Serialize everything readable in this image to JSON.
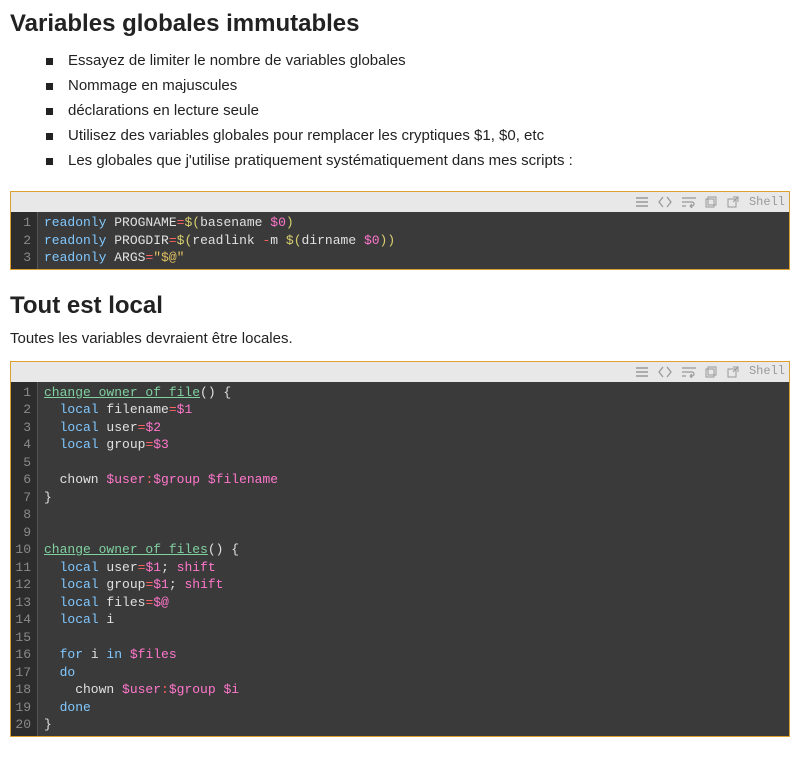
{
  "section1": {
    "heading": "Variables globales immutables",
    "bullets": [
      "Essayez de limiter le nombre de variables globales",
      "Nommage en majuscules",
      "déclarations en lecture seule",
      "Utilisez des variables globales pour remplacer les cryptiques $1, $0, etc",
      "Les globales que j'utilise pratiquement systématiquement dans mes scripts :"
    ]
  },
  "code1": {
    "lang": "Shell",
    "lines": [
      [
        [
          "kw",
          "readonly"
        ],
        [
          "cmd",
          " PROGNAME"
        ],
        [
          "op",
          "="
        ],
        [
          "subsh",
          "$("
        ],
        [
          "cmd",
          "basename "
        ],
        [
          "arg",
          "$0"
        ],
        [
          "subsh",
          ")"
        ]
      ],
      [
        [
          "kw",
          "readonly"
        ],
        [
          "cmd",
          " PROGDIR"
        ],
        [
          "op",
          "="
        ],
        [
          "subsh",
          "$("
        ],
        [
          "cmd",
          "readlink "
        ],
        [
          "op",
          "-"
        ],
        [
          "cmd",
          "m "
        ],
        [
          "subsh",
          "$("
        ],
        [
          "cmd",
          "dirname "
        ],
        [
          "arg",
          "$0"
        ],
        [
          "subsh",
          "))"
        ]
      ],
      [
        [
          "kw",
          "readonly"
        ],
        [
          "cmd",
          " ARGS"
        ],
        [
          "op",
          "="
        ],
        [
          "str",
          "\"$@\""
        ]
      ]
    ]
  },
  "section2": {
    "heading": "Tout est local",
    "para": "Toutes les variables devraient être locales."
  },
  "code2": {
    "lang": "Shell",
    "lines": [
      [
        [
          "fn",
          "change_owner_of_file"
        ],
        [
          "brace",
          "() {"
        ]
      ],
      [
        [
          "cmd",
          "  "
        ],
        [
          "kw",
          "local"
        ],
        [
          "cmd",
          " filename"
        ],
        [
          "op",
          "="
        ],
        [
          "arg",
          "$1"
        ]
      ],
      [
        [
          "cmd",
          "  "
        ],
        [
          "kw",
          "local"
        ],
        [
          "cmd",
          " user"
        ],
        [
          "op",
          "="
        ],
        [
          "arg",
          "$2"
        ]
      ],
      [
        [
          "cmd",
          "  "
        ],
        [
          "kw",
          "local"
        ],
        [
          "cmd",
          " group"
        ],
        [
          "op",
          "="
        ],
        [
          "arg",
          "$3"
        ]
      ],
      [
        [
          "cmd",
          " "
        ]
      ],
      [
        [
          "cmd",
          "  chown "
        ],
        [
          "arg",
          "$user"
        ],
        [
          "op",
          ":"
        ],
        [
          "arg",
          "$group"
        ],
        [
          "cmd",
          " "
        ],
        [
          "arg",
          "$filename"
        ]
      ],
      [
        [
          "brace",
          "}"
        ]
      ],
      [
        [
          "cmd",
          " "
        ]
      ],
      [
        [
          "cmd",
          " "
        ]
      ],
      [
        [
          "fn",
          "change_owner_of_files"
        ],
        [
          "brace",
          "() {"
        ]
      ],
      [
        [
          "cmd",
          "  "
        ],
        [
          "kw",
          "local"
        ],
        [
          "cmd",
          " user"
        ],
        [
          "op",
          "="
        ],
        [
          "arg",
          "$1"
        ],
        [
          "cmd",
          "; "
        ],
        [
          "arg",
          "shift"
        ]
      ],
      [
        [
          "cmd",
          "  "
        ],
        [
          "kw",
          "local"
        ],
        [
          "cmd",
          " group"
        ],
        [
          "op",
          "="
        ],
        [
          "arg",
          "$1"
        ],
        [
          "cmd",
          "; "
        ],
        [
          "arg",
          "shift"
        ]
      ],
      [
        [
          "cmd",
          "  "
        ],
        [
          "kw",
          "local"
        ],
        [
          "cmd",
          " files"
        ],
        [
          "op",
          "="
        ],
        [
          "arg",
          "$@"
        ]
      ],
      [
        [
          "cmd",
          "  "
        ],
        [
          "kw",
          "local"
        ],
        [
          "cmd",
          " i"
        ]
      ],
      [
        [
          "cmd",
          " "
        ]
      ],
      [
        [
          "cmd",
          "  "
        ],
        [
          "kw",
          "for"
        ],
        [
          "cmd",
          " i "
        ],
        [
          "kw",
          "in"
        ],
        [
          "cmd",
          " "
        ],
        [
          "arg",
          "$files"
        ]
      ],
      [
        [
          "cmd",
          "  "
        ],
        [
          "kw",
          "do"
        ]
      ],
      [
        [
          "cmd",
          "    chown "
        ],
        [
          "arg",
          "$user"
        ],
        [
          "op",
          ":"
        ],
        [
          "arg",
          "$group"
        ],
        [
          "cmd",
          " "
        ],
        [
          "arg",
          "$i"
        ]
      ],
      [
        [
          "cmd",
          "  "
        ],
        [
          "kw",
          "done"
        ]
      ],
      [
        [
          "brace",
          "}"
        ]
      ]
    ]
  }
}
